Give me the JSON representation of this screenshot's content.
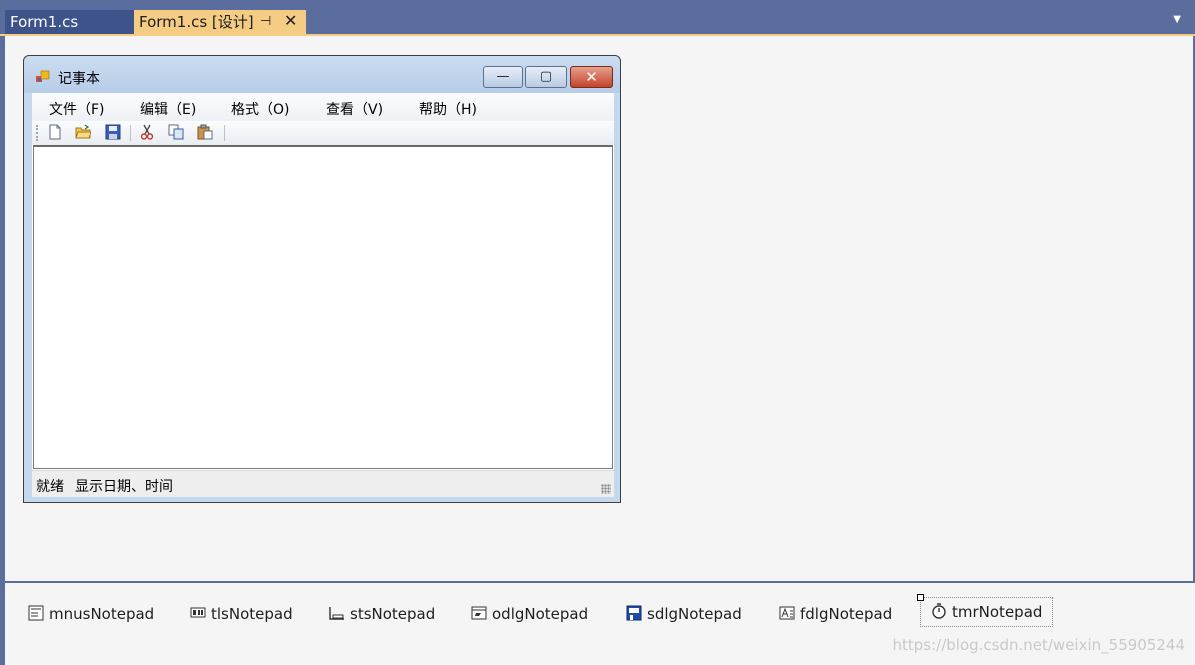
{
  "ide": {
    "tabs": [
      {
        "label": "Form1.cs"
      },
      {
        "label": "Form1.cs [设计]"
      }
    ],
    "pin_glyph": "⊣",
    "close_glyph": "✕",
    "overflow_glyph": "▼"
  },
  "form": {
    "title": "记事本",
    "caption_buttons": {
      "minimize": "—",
      "maximize": "▢",
      "close": "✕"
    },
    "menu": [
      {
        "label": "文件（F)"
      },
      {
        "label": "编辑（E)"
      },
      {
        "label": "格式（O)"
      },
      {
        "label": "查看（V)"
      },
      {
        "label": "帮助（H)"
      }
    ],
    "toolbar": [
      "new-file-icon",
      "open-folder-icon",
      "save-icon",
      "cut-icon",
      "copy-icon",
      "paste-icon"
    ],
    "text_content": "",
    "status": {
      "ready": "就绪",
      "datetime": "显示日期、时间"
    }
  },
  "tray": {
    "components": [
      {
        "name": "mnusNotepad",
        "icon": "menu-strip-icon"
      },
      {
        "name": "tlsNotepad",
        "icon": "toolstrip-icon"
      },
      {
        "name": "stsNotepad",
        "icon": "statusstrip-icon"
      },
      {
        "name": "odlgNotepad",
        "icon": "open-dialog-icon"
      },
      {
        "name": "sdlgNotepad",
        "icon": "save-dialog-icon"
      },
      {
        "name": "fdlgNotepad",
        "icon": "font-dialog-icon"
      },
      {
        "name": "tmrNotepad",
        "icon": "timer-icon",
        "selected": true
      }
    ]
  },
  "watermark": "https://blog.csdn.net/weixin_55905244",
  "colors": {
    "ide_chrome": "#5b6d9c",
    "active_tab": "#f5cc84",
    "inactive_tab": "#3e5389",
    "form_frame": "#c4d8ee"
  }
}
